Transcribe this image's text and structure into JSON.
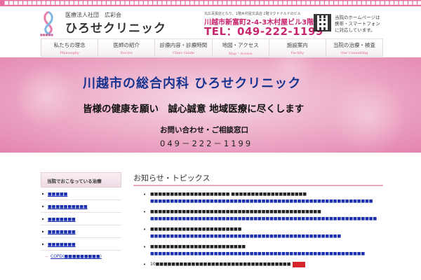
{
  "top_strip": {
    "text": "■■■■■■■■■■■■■■■■■■■■■■■■■■■■■■■■■■■■■■■■■■■■■■■■■■■■■■■■■■■■■■■■■■■■■■■■■■■■■■■■■■■■■■■■■■■■■■■■■■■■■■■■■■■■"
  },
  "header": {
    "corp_name": "医療法人社団　広彩会",
    "clinic_name": "ひろせクリニック",
    "address": "丸広百貨店となり、1階木村屋文具店  2階マクドナルドのビル",
    "address2": "川越市新富町2-4-3木村屋ビル3階",
    "tel": "TEL：049-222-1199",
    "mobile_note": "当院のホームページは携帯・スマートフォンに対応しています。"
  },
  "nav": [
    {
      "jp": "私たちの理念",
      "en": "Philosophy"
    },
    {
      "jp": "医師の紹介",
      "en": "Doctor"
    },
    {
      "jp": "診療内容・診療時間",
      "en": "Clinic Guide"
    },
    {
      "jp": "地図・アクセス",
      "en": "Map・Access"
    },
    {
      "jp": "施設案内",
      "en": "Facility"
    },
    {
      "jp": "当院の治療・検査",
      "en": "Our Consulting"
    }
  ],
  "hero": {
    "title": "川越市の総合内科 ひろせクリニック",
    "subtitle": "皆様の健康を願い　誠心誠意 地域医療に尽くします",
    "contact_label": "お問い合わせ・ご相談窓口",
    "tel": "049－222－1199"
  },
  "sidebar": {
    "heading": "当院でおこなっている治療",
    "items": [
      "■■■■■",
      "■■■■■■■■■■",
      "■■■■■■■",
      "■■■■■■■",
      "■■■■■■■"
    ],
    "sub_item": "COPD(■■■■■■■■■)"
  },
  "news": {
    "title": "お知らせ・トピックス",
    "items": [
      {
        "line": "■■■■■■■■■■■■■■■■■■■■ ■■■■■■■■■■■■■■■■■■■",
        "link": "■■■■■■■■■■■■■■■■■■■■■■■■■■■■■■■■■■■■■■■■■■■■■■■■■■■■■■■■"
      },
      {
        "line": "■■■■■■■■■■■■■■■■■■■■■■■■■■■■■■■■■■■■■■■■■■■",
        "link": "■■■■■■■■■■■■■■■■■■■■■■■■■■■■■■■■■■■■■■■■■■■■■■■■■■■■■■■■■"
      },
      {
        "line": "■■■■■■■■■■■■■■■■■■■■■■■",
        "link": "■■■■■■■■■■■■■■■■■■■■■■■■■■■■■■■■■■■■■■■■■■■■■■■■"
      },
      {
        "line": "■■■■■■■■■■■■■■■■■■■■■■■■",
        "link": "■■■■■■■■■■■■■■■■■■■■■■■■■■■■■■■■■■■■■■■■■■■■■■■■■■■■■■"
      },
      {
        "line": "10■■■■■■■■■■■■■■■■■■■■■■■■■■■■■■■■■■",
        "link": ""
      }
    ]
  },
  "colors": {
    "brand_pink": "#e56f9e",
    "tel_red": "#c8266f",
    "hero_blue": "#16348f",
    "link_blue": "#1a2fb0"
  }
}
